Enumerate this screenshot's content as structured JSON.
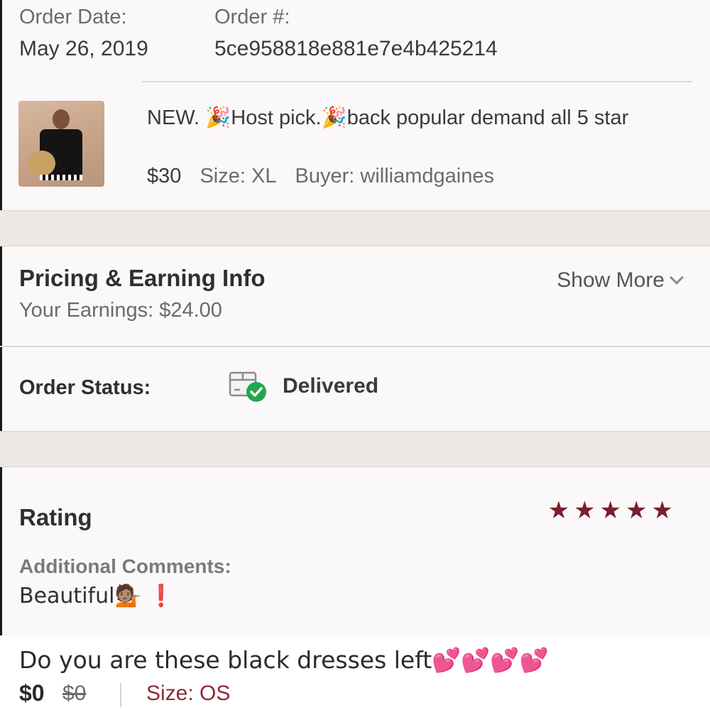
{
  "order": {
    "date_label": "Order Date:",
    "date_value": "May 26, 2019",
    "number_label": "Order #:",
    "number_value": "5ce958818e881e7e4b425214"
  },
  "item": {
    "image": "dress-thumbnail",
    "title": "NEW. 🎉Host pick.🎉back popular demand all 5 star",
    "price": "$30",
    "size": "Size: XL",
    "buyer": "Buyer: williamdgaines"
  },
  "pricing": {
    "title": "Pricing & Earning Info",
    "earnings": "Your Earnings: $24.00",
    "show_more": "Show More",
    "show_more_icon": "chevron-down-icon"
  },
  "status": {
    "label": "Order Status:",
    "icon": "delivered-box-icon",
    "value": "Delivered",
    "check_color": "#1fa84b"
  },
  "rating": {
    "label": "Rating",
    "stars": 5,
    "max_stars": 5,
    "star_color": "#7a1f2e",
    "comments_label": "Additional Comments:",
    "comment": "Beautiful💁🏽 ❗"
  },
  "listing": {
    "title": "Do you are these black dresses left💕💕💕💕",
    "price": "$0",
    "original_price": "$0",
    "size": "Size: OS"
  }
}
